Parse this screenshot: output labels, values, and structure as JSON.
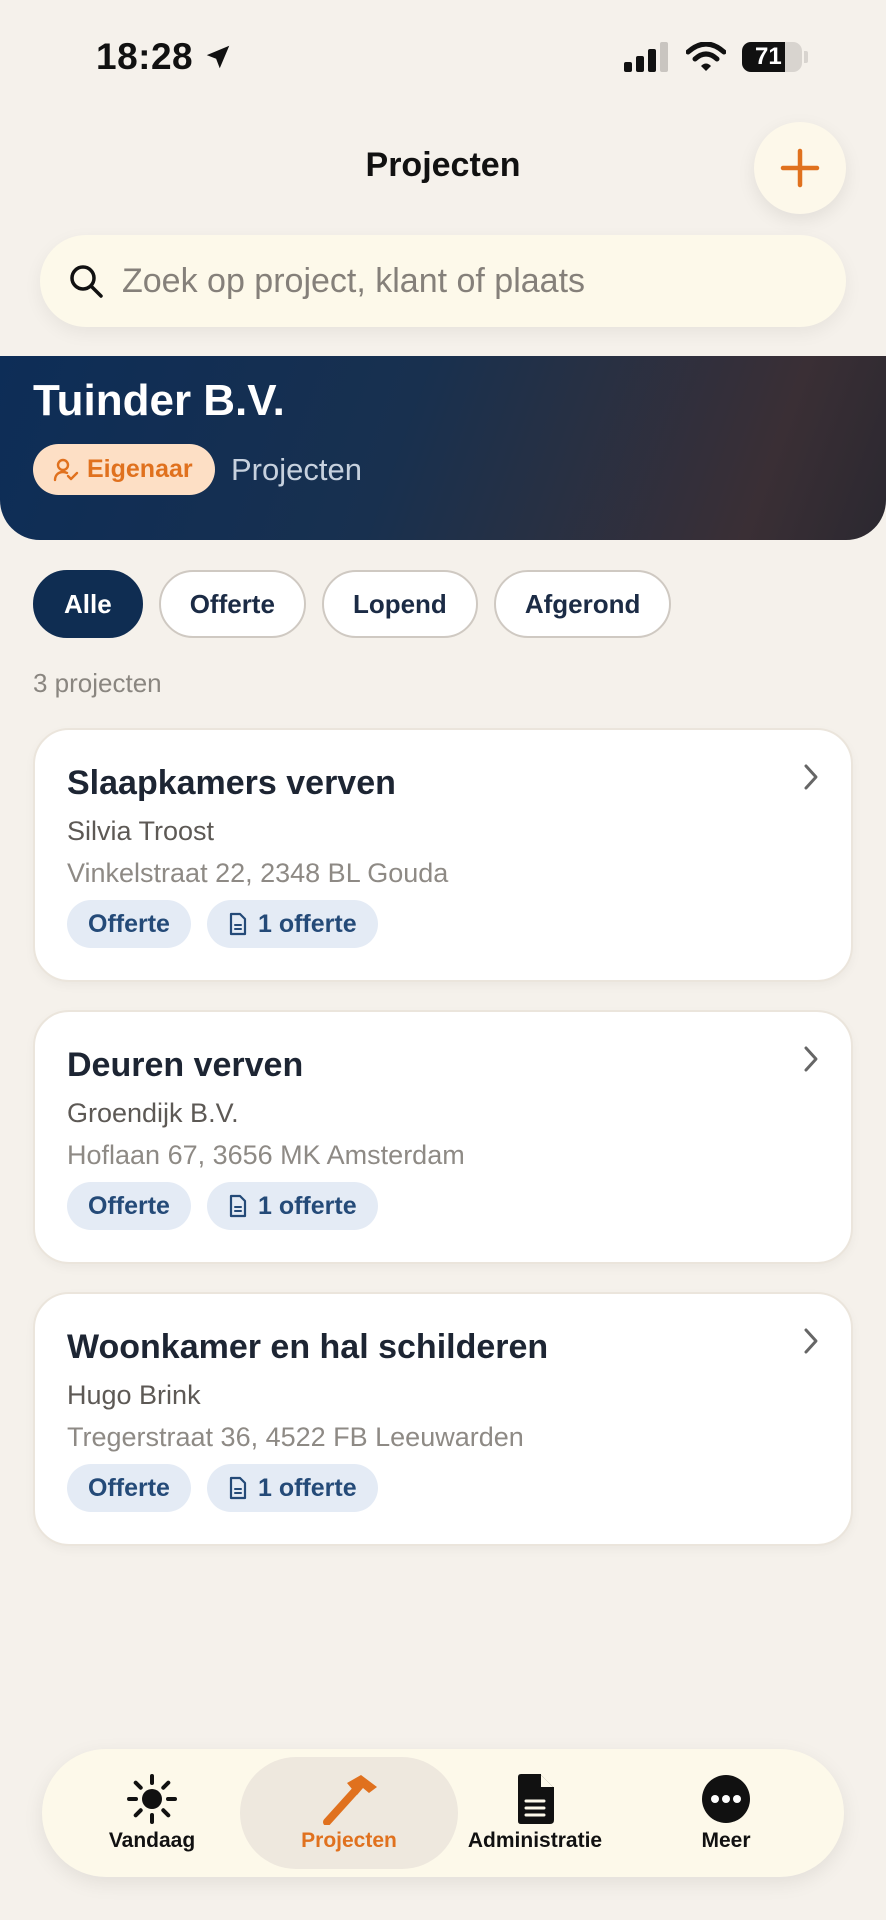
{
  "status_bar": {
    "time": "18:28",
    "battery": "71"
  },
  "header": {
    "title": "Projecten"
  },
  "search": {
    "placeholder": "Zoek op project, klant of plaats"
  },
  "company": {
    "name": "Tuinder B.V.",
    "role": "Eigenaar",
    "section": "Projecten"
  },
  "filters": [
    {
      "label": "Alle",
      "active": true
    },
    {
      "label": "Offerte",
      "active": false
    },
    {
      "label": "Lopend",
      "active": false
    },
    {
      "label": "Afgerond",
      "active": false
    }
  ],
  "project_count": "3 projecten",
  "projects": [
    {
      "title": "Slaapkamers verven",
      "client": "Silvia Troost",
      "address": "Vinkelstraat 22, 2348 BL Gouda",
      "status": "Offerte",
      "quotes": "1 offerte"
    },
    {
      "title": "Deuren verven",
      "client": "Groendijk B.V.",
      "address": "Hoflaan 67, 3656 MK Amsterdam",
      "status": "Offerte",
      "quotes": "1 offerte"
    },
    {
      "title": "Woonkamer en hal schilderen",
      "client": "Hugo Brink",
      "address": "Tregerstraat 36, 4522 FB Leeuwarden",
      "status": "Offerte",
      "quotes": "1 offerte"
    }
  ],
  "nav": [
    {
      "label": "Vandaag",
      "icon": "sun-icon",
      "active": false
    },
    {
      "label": "Projecten",
      "icon": "hammer-icon",
      "active": true
    },
    {
      "label": "Administratie",
      "icon": "document-icon",
      "active": false
    },
    {
      "label": "Meer",
      "icon": "more-icon",
      "active": false
    }
  ],
  "colors": {
    "accent": "#e0711e",
    "navy": "#0f2d52",
    "background": "#f5f1eb"
  }
}
